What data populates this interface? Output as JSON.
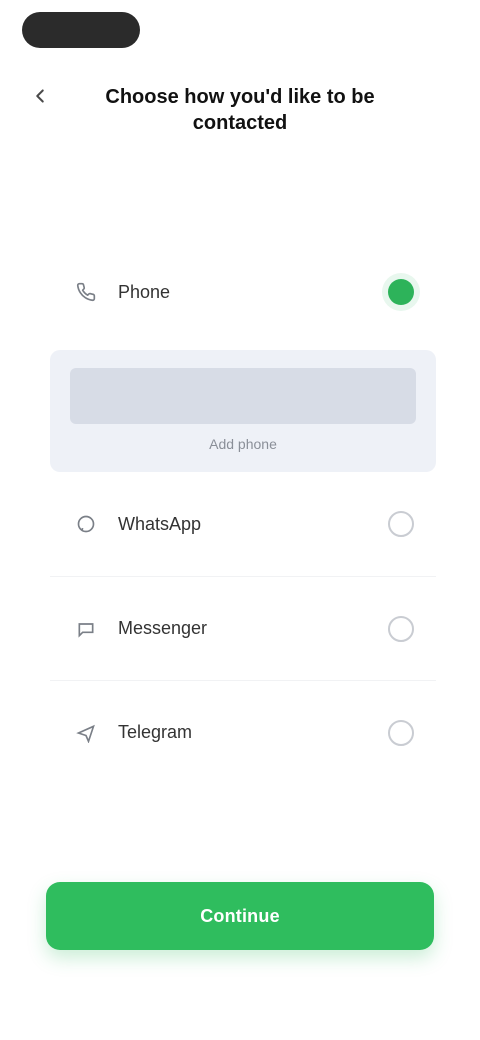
{
  "header": {
    "title": "Choose how you'd like to be contacted"
  },
  "options": [
    {
      "label": "Phone",
      "icon": "phone-icon",
      "selected": true
    },
    {
      "label": "WhatsApp",
      "icon": "whatsapp-icon",
      "selected": false
    },
    {
      "label": "Messenger",
      "icon": "messenger-icon",
      "selected": false
    },
    {
      "label": "Telegram",
      "icon": "telegram-icon",
      "selected": false
    }
  ],
  "expanded_helper": "Add phone",
  "cta": {
    "label": "Continue"
  },
  "colors": {
    "accent": "#2fbd5e",
    "panel": "#eef1f7"
  }
}
